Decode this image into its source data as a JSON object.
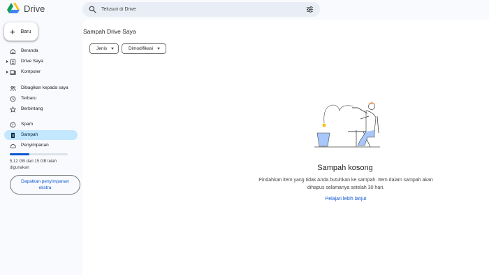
{
  "app": {
    "title": "Drive"
  },
  "search": {
    "placeholder": "Telusuri di Drive"
  },
  "sidebar": {
    "new_label": "Baru",
    "items": [
      {
        "label": "Beranda"
      },
      {
        "label": "Drive Saya"
      },
      {
        "label": "Komputer"
      },
      {
        "label": "Dibagikan kepada saya"
      },
      {
        "label": "Terbaru"
      },
      {
        "label": "Berbintang"
      },
      {
        "label": "Spam"
      },
      {
        "label": "Sampah"
      },
      {
        "label": "Penyimpanan"
      }
    ],
    "active_item": "Sampah",
    "storage": {
      "used_fraction": 0.341,
      "text": "5,12 GB dari 15 GB telah digunakan",
      "button_label": "Dapatkan penyimpanan ekstra"
    }
  },
  "main": {
    "title": "Sampah Drive Saya",
    "filters": [
      {
        "label": "Jenis"
      },
      {
        "label": "Dimodifikasi"
      }
    ],
    "empty_state": {
      "title": "Sampah kosong",
      "description": "Pindahkan item yang tidak Anda butuhkan ke sampah. Item dalam sampah akan dihapus selamanya setelah 30 hari.",
      "link": "Pelajari lebih lanjut"
    }
  },
  "colors": {
    "accent": "#0b57d0",
    "active_bg": "#c2e7ff",
    "search_bg": "#e9eef6",
    "page_bg": "#f8fafd"
  }
}
